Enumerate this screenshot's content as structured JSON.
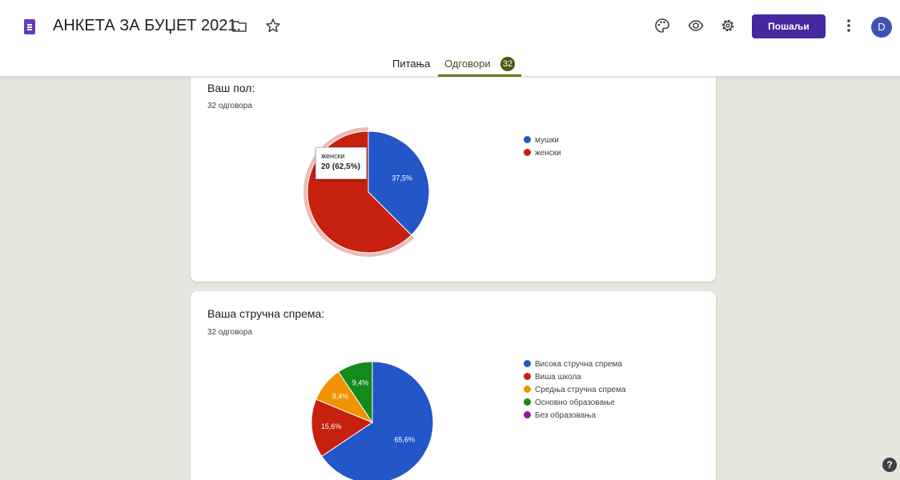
{
  "header": {
    "doc_title": "АНКЕТА ЗА БУЏЕТ 2021.",
    "send_label": "Пошаљи",
    "avatar_letter": "D",
    "accent_color": "#4527a0"
  },
  "tabs": {
    "questions_label": "Питања",
    "responses_label": "Одговори",
    "responses_badge": "32"
  },
  "questions": [
    {
      "title": "Ваш пол:",
      "count_label": "32 одговора",
      "tooltip": {
        "label": "женски",
        "value": "20 (62,5%)"
      },
      "chart_data": {
        "type": "pie",
        "categories": [
          "мушки",
          "женски"
        ],
        "values": [
          37.5,
          62.5
        ],
        "value_labels": [
          "37,5%",
          ""
        ],
        "colors": [
          "#2356c7",
          "#c7200f"
        ],
        "legend": "right"
      }
    },
    {
      "title": "Ваша стручна спрема:",
      "count_label": "32 одговора",
      "chart_data": {
        "type": "pie",
        "categories": [
          "Висока стручна спрема",
          "Виша школа",
          "Средња стручна спрема",
          "Основно образовање",
          "Без образовања"
        ],
        "values": [
          65.6,
          15.6,
          9.4,
          9.4,
          0
        ],
        "value_labels": [
          "65,6%",
          "15,6%",
          "9,4%",
          "9,4%",
          ""
        ],
        "colors": [
          "#2356c7",
          "#c7200f",
          "#f39200",
          "#148a1e",
          "#8e1b9a"
        ],
        "legend": "right"
      }
    }
  ],
  "help_label": "?"
}
